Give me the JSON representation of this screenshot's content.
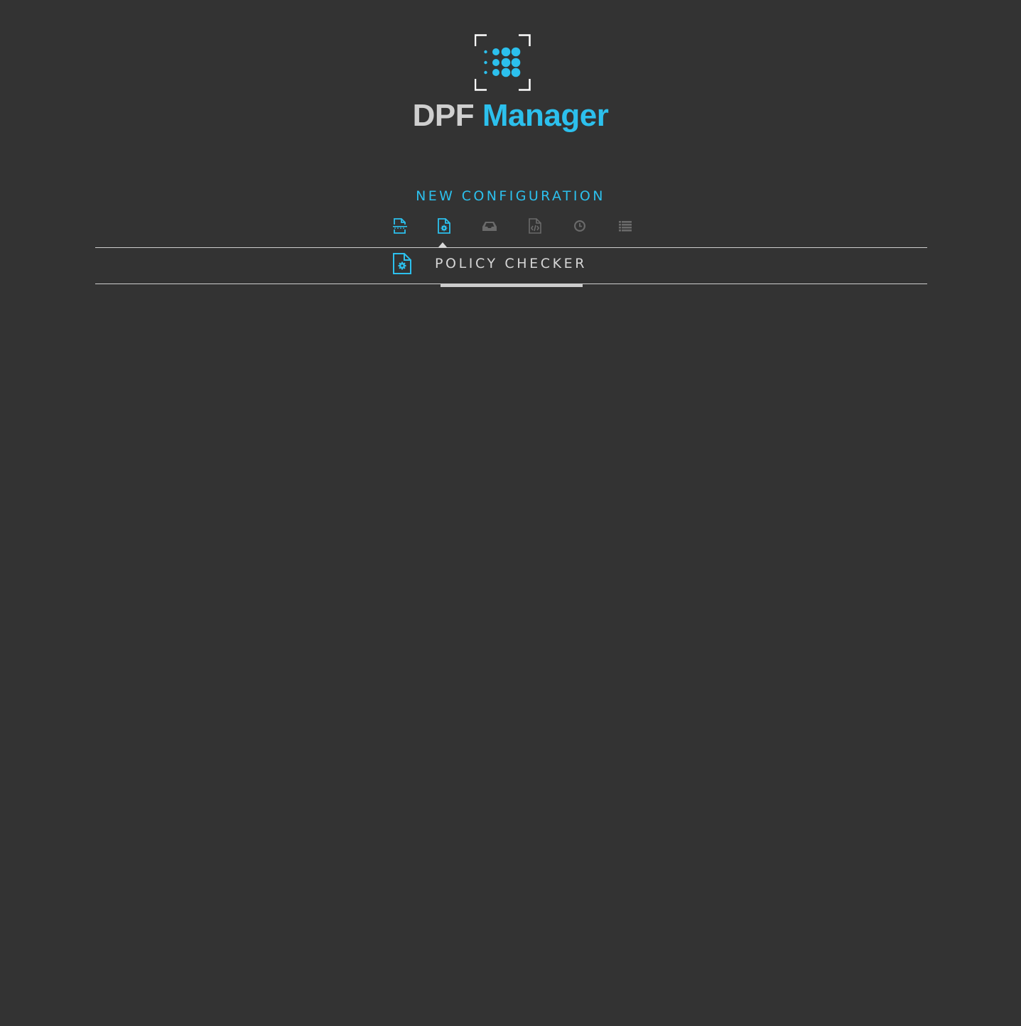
{
  "app": {
    "title_part1": "DPF",
    "title_part2": "Manager"
  },
  "colors": {
    "background": "#333333",
    "accent": "#2cc0ed",
    "inactive_icon": "#6a6a6a",
    "text_light": "#d6d6d6"
  },
  "section_title": "NEW CONFIGURATION",
  "steps": [
    {
      "name": "file-format-icon",
      "state": "done"
    },
    {
      "name": "policy-checker-icon",
      "state": "active"
    },
    {
      "name": "inbox-icon",
      "state": "inactive"
    },
    {
      "name": "code-file-icon",
      "state": "inactive"
    },
    {
      "name": "clock-icon",
      "state": "inactive"
    },
    {
      "name": "list-icon",
      "state": "inactive"
    }
  ],
  "current_step": {
    "icon": "policy-checker-icon",
    "label": "POLICY CHECKER"
  }
}
